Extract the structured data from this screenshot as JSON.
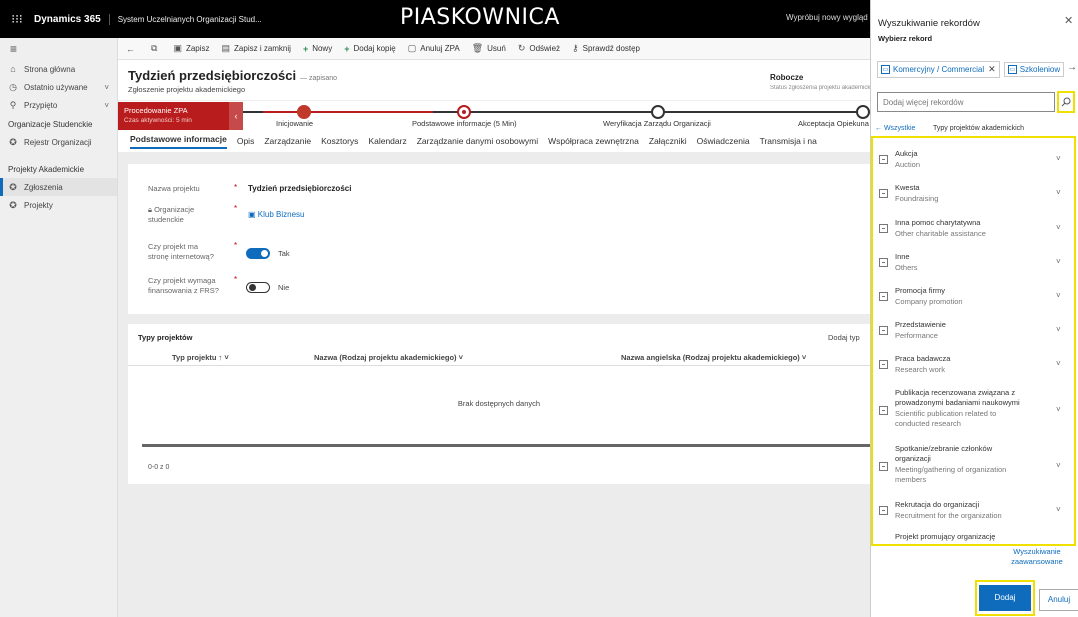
{
  "topbar": {
    "app_name": "Dynamics 365",
    "app_subtitle": "System Uczelnianych Organizacji Stud...",
    "environment": "PIASKOWNICA",
    "try_new": "Wypróbuj nowy wygląd"
  },
  "leftnav": {
    "items": [
      {
        "label": "Strona główna",
        "icon": "home-icon"
      },
      {
        "label": "Ostatnio używane",
        "icon": "clock-icon"
      },
      {
        "label": "Przypięto",
        "icon": "pin-icon"
      }
    ],
    "group1": "Organizacje Studenckie",
    "group1_items": [
      {
        "label": "Rejestr Organizacji"
      }
    ],
    "group2": "Projekty Akademickie",
    "group2_items": [
      {
        "label": "Zgłoszenia",
        "active": true
      },
      {
        "label": "Projekty"
      }
    ]
  },
  "cmdbar": {
    "save": "Zapisz",
    "save_close": "Zapisz i zamknij",
    "new": "Nowy",
    "copy": "Dodaj kopię",
    "cancel_zpa": "Anuluj ZPA",
    "delete": "Usuń",
    "refresh": "Odśwież",
    "check_access": "Sprawdź dostęp"
  },
  "form": {
    "title": "Tydzień przedsiębiorczości",
    "saved": "— zapisano",
    "subtitle": "Zgłoszenie projektu akademickiego",
    "status": "Robocze",
    "status_sub": "Status zgłoszenia projektu akademickiego"
  },
  "bpf": {
    "active_name": "Procedowanie ZPA",
    "active_time": "Czas aktywności: 5 min",
    "stages": [
      "Inicjowanie",
      "Podstawowe informacje (5 Min)",
      "Weryfikacja Zarządu Organizacji",
      "Akceptacja Opiekuna"
    ]
  },
  "tabs": [
    "Podstawowe informacje",
    "Opis",
    "Zarządzanie",
    "Kosztorys",
    "Kalendarz",
    "Zarządzanie danymi osobowymi",
    "Współpraca zewnętrzna",
    "Załączniki",
    "Oświadczenia",
    "Transmisja i na"
  ],
  "fields": {
    "name_label": "Nazwa projektu",
    "name_value": "Tydzień przedsiębiorczości",
    "org_label1": "Organizacje",
    "org_label2": "studenckie",
    "org_value": "Klub Biznesu",
    "web_label1": "Czy projekt ma",
    "web_label2": "stronę internetową?",
    "web_value": "Tak",
    "frs_label1": "Czy projekt wymaga",
    "frs_label2": "finansowania z FRS?",
    "frs_value": "Nie"
  },
  "grid": {
    "title": "Typy projektów",
    "add": "Dodaj typ",
    "col1": "Typ projektu ↑ ˅",
    "col2": "Nazwa (Rodzaj projektu akademickiego) ˅",
    "col3": "Nazwa angielska (Rodzaj projektu akademickiego) ˅",
    "empty": "Brak dostępnych danych",
    "count": "0-0 z 0"
  },
  "panel": {
    "title": "Wyszukiwanie rekordów",
    "subtitle": "Wybierz rekord",
    "chips": [
      "Komercyjny / Commercial",
      "Szkoleniow"
    ],
    "search_placeholder": "Dodaj więcej rekordów",
    "all_link": "← Wszystkie",
    "list_title": "Typy projektów akademickich",
    "items": [
      {
        "pl": "Aukcja",
        "en": "Auction"
      },
      {
        "pl": "Kwesta",
        "en": "Foundraising"
      },
      {
        "pl": "Inna pomoc charytatywna",
        "en": "Other charitable assistance"
      },
      {
        "pl": "Inne",
        "en": "Others"
      },
      {
        "pl": "Promocja firmy",
        "en": "Company promotion"
      },
      {
        "pl": "Przedstawienie",
        "en": "Performance"
      },
      {
        "pl": "Praca badawcza",
        "en": "Research work"
      },
      {
        "pl1": "Publikacja recenzowana związana z",
        "pl2": "prowadzonymi badaniami naukowymi",
        "en1": "Scientific publication related to",
        "en2": "conducted research"
      },
      {
        "pl1": "Spotkanie/zebranie członków",
        "pl2": "organizacji",
        "en1": "Meeting/gathering of organization",
        "en2": "members"
      },
      {
        "pl": "Rekrutacja do organizacji",
        "en": "Recruitment for the organization"
      },
      {
        "pl": "Projekt promujący organizację"
      }
    ],
    "advanced1": "Wyszukiwanie",
    "advanced2": "zaawansowane",
    "add_button": "Dodaj",
    "cancel_button": "Anuluj"
  },
  "colors": {
    "accent": "#0f6cbd",
    "bpf_active": "#b91c1c",
    "highlight": "#f0e000"
  }
}
